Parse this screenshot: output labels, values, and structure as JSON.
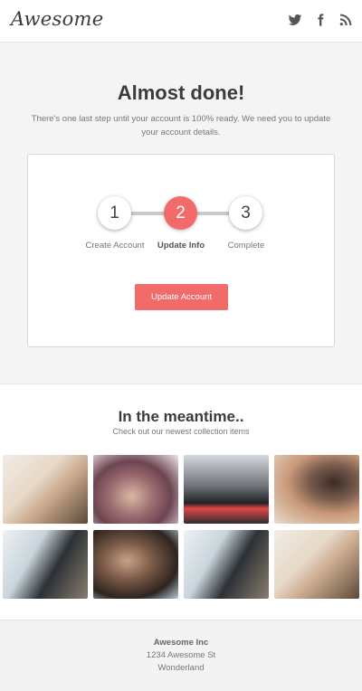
{
  "header": {
    "logo": "Awesome",
    "social": [
      {
        "icon": "twitter-icon"
      },
      {
        "icon": "facebook-icon"
      },
      {
        "icon": "rss-icon"
      }
    ]
  },
  "hero": {
    "title": "Almost done!",
    "subtitle": "There's one last step until your account is 100% ready. We need you to update your account details."
  },
  "steps": [
    {
      "number": "1",
      "label": "Create Account",
      "active": false
    },
    {
      "number": "2",
      "label": "Update Info",
      "active": true
    },
    {
      "number": "3",
      "label": "Complete",
      "active": false
    }
  ],
  "cta": {
    "label": "Update Account"
  },
  "meantime": {
    "title": "In the meantime..",
    "subtitle": "Check out our newest collection items"
  },
  "footer": {
    "company": "Awesome Inc",
    "address_line1": "1234 Awesome St",
    "address_line2": "Wonderland"
  },
  "colors": {
    "accent": "#f26b6b",
    "background": "#f3f3f3"
  }
}
